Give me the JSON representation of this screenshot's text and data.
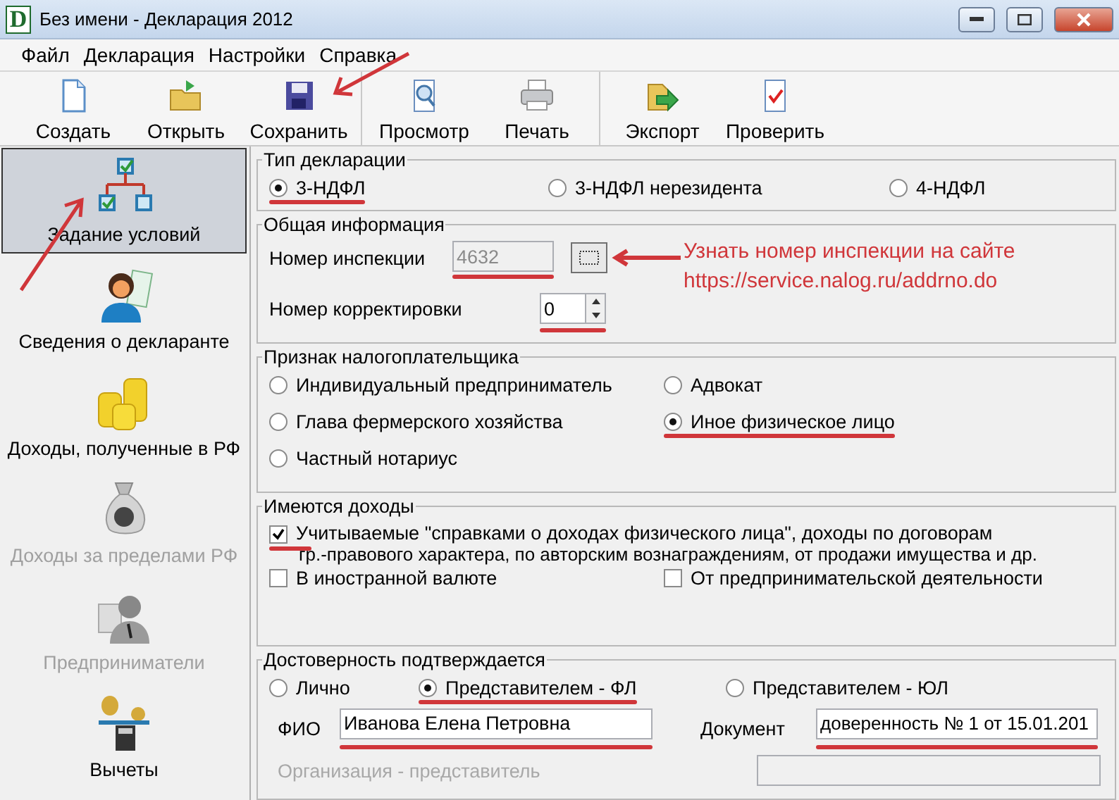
{
  "window": {
    "logo_letter": "D",
    "title": "Без имени - Декларация 2012"
  },
  "menu": [
    "Файл",
    "Декларация",
    "Настройки",
    "Справка"
  ],
  "toolbar": [
    [
      {
        "label": "Создать",
        "kind": "new"
      },
      {
        "label": "Открыть",
        "kind": "open"
      },
      {
        "label": "Сохранить",
        "kind": "save"
      }
    ],
    [
      {
        "label": "Просмотр",
        "kind": "preview"
      },
      {
        "label": "Печать",
        "kind": "print"
      }
    ],
    [
      {
        "label": "Экспорт",
        "kind": "export"
      },
      {
        "label": "Проверить",
        "kind": "check"
      }
    ]
  ],
  "sidebar": [
    {
      "label": "Задание условий",
      "kind": "tree",
      "selected": true,
      "disabled": false
    },
    {
      "label": "Сведения о декларанте",
      "kind": "person",
      "selected": false,
      "disabled": false
    },
    {
      "label": "Доходы, полученные в РФ",
      "kind": "coins",
      "selected": false,
      "disabled": false
    },
    {
      "label": "Доходы за пределами РФ",
      "kind": "moneybag",
      "selected": false,
      "disabled": true
    },
    {
      "label": "Предприниматели",
      "kind": "business",
      "selected": false,
      "disabled": true
    },
    {
      "label": "Вычеты",
      "kind": "scales",
      "selected": false,
      "disabled": false
    }
  ],
  "declaration_type": {
    "title": "Тип декларации",
    "options": [
      {
        "label": "3-НДФЛ",
        "selected": true,
        "marked": true
      },
      {
        "label": "3-НДФЛ нерезидента",
        "selected": false,
        "marked": false
      },
      {
        "label": "4-НДФЛ",
        "selected": false,
        "marked": false
      }
    ]
  },
  "general": {
    "title": "Общая информация",
    "inspection": {
      "label": "Номер инспекции",
      "value": "4632",
      "disabled": true,
      "marked": true
    },
    "correction": {
      "label": "Номер корректировки",
      "value": "0",
      "marked": true
    },
    "annotation": {
      "text": "Узнать номер инспекции на сайте",
      "url": "https://service.nalog.ru/addrno.do"
    }
  },
  "taxpayer": {
    "title": "Признак налогоплательщика",
    "options": [
      {
        "label": "Индивидуальный предприниматель",
        "selected": false,
        "marked": false
      },
      {
        "label": "Адвокат",
        "selected": false,
        "marked": false
      },
      {
        "label": "Глава фермерского хозяйства",
        "selected": false,
        "marked": false
      },
      {
        "label": "Иное физическое лицо",
        "selected": true,
        "marked": true
      },
      {
        "label": "Частный нотариус",
        "selected": false,
        "marked": false
      }
    ]
  },
  "income": {
    "title": "Имеются доходы",
    "main": {
      "label": "Учитываемые \"справками о доходах физического лица\", доходы по договорам",
      "continuation": "гр.-правового характера, по авторским вознаграждениям, от продажи имущества и др.",
      "checked": true,
      "marked": true
    },
    "items": [
      {
        "label": "В иностранной валюте",
        "checked": false
      },
      {
        "label": "От предпринимательской деятельности",
        "checked": false
      }
    ]
  },
  "confirmation": {
    "title": "Достоверность подтверждается",
    "options": [
      {
        "label": "Лично",
        "selected": false,
        "marked": false
      },
      {
        "label": "Представителем - ФЛ",
        "selected": true,
        "marked": true
      },
      {
        "label": "Представителем - ЮЛ",
        "selected": false,
        "marked": false
      }
    ],
    "name": {
      "label": "ФИО",
      "value": "Иванова Елена Петровна",
      "marked": true
    },
    "document": {
      "label": "Документ",
      "value": "доверенность № 1 от 15.01.201",
      "marked": true
    },
    "organization": {
      "label": "Организация - представитель",
      "disabled": true
    }
  }
}
